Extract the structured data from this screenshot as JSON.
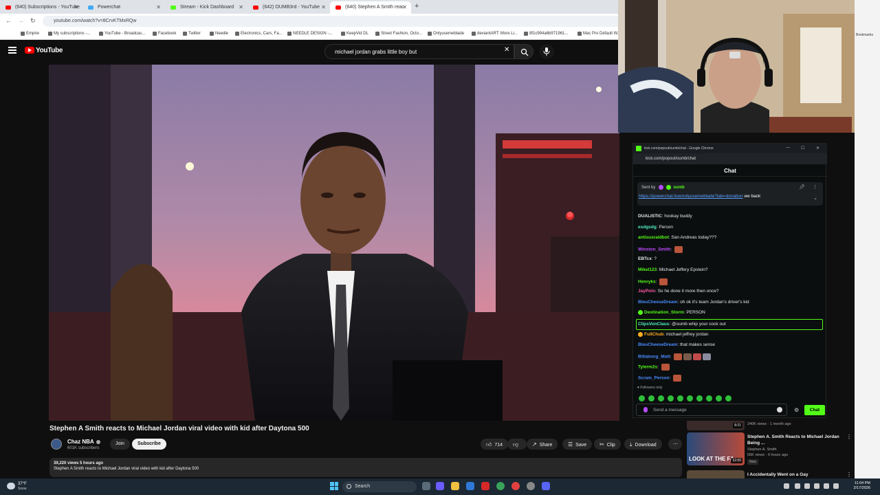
{
  "browser": {
    "tabs": [
      {
        "label": "(640) Subscriptions - YouTube",
        "color": "#ff0000"
      },
      {
        "label": "Powerchat",
        "color": "#3fa9f5"
      },
      {
        "label": "Stream - Kick Dashboard",
        "color": "#53fc18"
      },
      {
        "label": "(642) OUMB3rd - YouTube",
        "color": "#ff0000"
      },
      {
        "label": "(640) Stephen A Smith reac",
        "color": "#ff0000"
      }
    ],
    "url": "youtube.com/watch?v=8CrvKTMxRQw",
    "bookmarks": [
      "Empire",
      "My subscriptions -...",
      "YouTube - Broadcas...",
      "Facebook",
      "Twitter",
      "Needle",
      "Electronics, Cars, Fa...",
      "NEEDLE DESIGN -...",
      "KeepVid DL",
      "Street Fashion, Octo...",
      "Onlyusemeblade",
      "deviantART: More Li...",
      "8f1c994a6b971961...",
      "Mac Pro Default W..."
    ],
    "bookmarks_overflow": "Bookmarks"
  },
  "youtube": {
    "brand": "YouTube",
    "search_query": "michael jordan grabs little boy but",
    "video_title": "Stephen A Smith reacts to Michael Jordan viral video with kid after Daytona 500",
    "channel_name": "Chaz NBA",
    "channel_subs": "601K subscribers",
    "join_label": "Join",
    "subscribe_label": "Subscribe",
    "likes": "714",
    "share_label": "Share",
    "save_label": "Save",
    "clip_label": "Clip",
    "download_label": "Download",
    "views_meta": "39,220 views  5 hours ago",
    "description": "Stephen A Smith reacts to Michael Jordan viral video with kid after Daytona 500"
  },
  "recommended": [
    {
      "title": "",
      "channel": "",
      "meta": "240K views · 1 month ago",
      "duration": "8:21",
      "new": ""
    },
    {
      "title": "Stephen A. Smith Reacts to Michael Jordan Being ...",
      "channel": "Stephen A. Smith",
      "meta": "56K views · 6 hours ago",
      "duration": "12:05",
      "new": "New",
      "thumb_text": "LOOK AT THE FA"
    },
    {
      "title": "I Accidentally Went on a Gay",
      "channel": "",
      "meta": "",
      "duration": "",
      "new": ""
    }
  ],
  "chat_window": {
    "title": "kick.com/popout/oumb/chat - Google Chrome",
    "url": "kick.com/popout/oumb/chat",
    "header": "Chat",
    "pinned_sent_by": "Sent by",
    "pinned_user": "oumb",
    "pinned_link": "https://powerchat.live/onlyusemeblade?tab=donation",
    "pinned_text": "we back",
    "messages": [
      {
        "user": "DUALISTIC",
        "color": "#e8e8e8",
        "text": "hookay buddy",
        "emotes": 0,
        "hl": false,
        "badge": ""
      },
      {
        "user": "esdgsdg",
        "color": "#4ff0c0",
        "text": "Person",
        "emotes": 0,
        "hl": false,
        "badge": ""
      },
      {
        "user": "antisusraidbot",
        "color": "#53fc18",
        "text": "San Andreas today???",
        "emotes": 0,
        "hl": false,
        "badge": ""
      },
      {
        "user": "Winston_Smith",
        "color": "#c04cff",
        "text": "",
        "emotes": 1,
        "hl": false,
        "badge": ""
      },
      {
        "user": "EBTcx",
        "color": "#e8e8e8",
        "text": "?",
        "emotes": 0,
        "hl": false,
        "badge": ""
      },
      {
        "user": "Mikel123",
        "color": "#53fc18",
        "text": "Michael Jeffery Epstein?",
        "emotes": 0,
        "hl": false,
        "badge": ""
      },
      {
        "user": "Henryks",
        "color": "#53fc18",
        "text": "",
        "emotes": 1,
        "hl": false,
        "badge": ""
      },
      {
        "user": "JayPolo",
        "color": "#ff5aa8",
        "text": "So he done it more then once?",
        "emotes": 0,
        "hl": false,
        "badge": ""
      },
      {
        "user": "BleuCheeseDream",
        "color": "#4a8cff",
        "text": "oh ok it's team Jordan's driver's kid",
        "emotes": 0,
        "hl": false,
        "badge": ""
      },
      {
        "user": "Destination_Storm",
        "color": "#53fc18",
        "text": "PERSON",
        "emotes": 0,
        "hl": false,
        "badge": "#53fc18"
      },
      {
        "user": "ClipsVonClaus",
        "color": "#4ff0c0",
        "text": "@oumb whip your cock out",
        "emotes": 0,
        "hl": true,
        "badge": ""
      },
      {
        "user": "FullChub",
        "color": "#ffb020",
        "text": "michael jeffrey jordan",
        "emotes": 0,
        "hl": false,
        "badge": "#ffb020"
      },
      {
        "user": "BleuCheeseDream",
        "color": "#4a8cff",
        "text": "that makes sense",
        "emotes": 0,
        "hl": false,
        "badge": ""
      },
      {
        "user": "Billabong_Matt",
        "color": "#4a8cff",
        "text": "",
        "emotes": 4,
        "hl": false,
        "badge": ""
      },
      {
        "user": "Tylerm2s",
        "color": "#53fc18",
        "text": "",
        "emotes": 1,
        "hl": false,
        "badge": ""
      },
      {
        "user": "Scram_Person",
        "color": "#4a8cff",
        "text": "",
        "emotes": 1,
        "hl": false,
        "badge": ""
      }
    ],
    "followers_only": "Followers only",
    "input_placeholder": "Send a message",
    "send_label": "Chat"
  },
  "taskbar": {
    "temp": "37°F",
    "condition": "Snow",
    "search_label": "Search",
    "time": "11:04 PM",
    "date": "2/17/2026"
  },
  "colors": {
    "youtube_red": "#ff0000",
    "kick_green": "#53fc18",
    "yt_bg": "#0f0f0f"
  }
}
